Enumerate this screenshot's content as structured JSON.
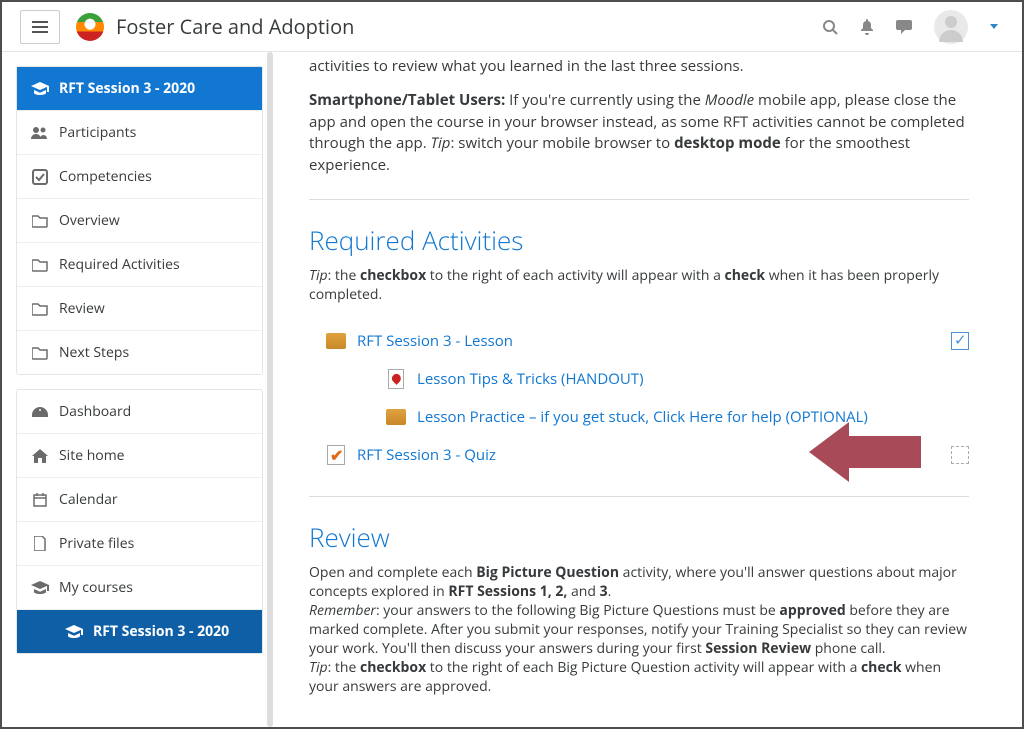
{
  "header": {
    "site_name": "Foster Care and Adoption"
  },
  "sidebar": {
    "course_items": [
      {
        "label": "RFT Session 3 - 2020",
        "icon": "graduation",
        "active": true
      },
      {
        "label": "Participants",
        "icon": "users"
      },
      {
        "label": "Competencies",
        "icon": "check-square"
      },
      {
        "label": "Overview",
        "icon": "folder"
      },
      {
        "label": "Required Activities",
        "icon": "folder"
      },
      {
        "label": "Review",
        "icon": "folder"
      },
      {
        "label": "Next Steps",
        "icon": "folder"
      }
    ],
    "global_items": [
      {
        "label": "Dashboard",
        "icon": "tachometer"
      },
      {
        "label": "Site home",
        "icon": "home"
      },
      {
        "label": "Calendar",
        "icon": "calendar"
      },
      {
        "label": "Private files",
        "icon": "file"
      },
      {
        "label": "My courses",
        "icon": "graduation"
      },
      {
        "label": "RFT Session 3 - 2020",
        "icon": "graduation",
        "active_bottom": true
      }
    ]
  },
  "intro": {
    "line1": "activities to review what you learned in the last three sessions.",
    "smartphone_label": "Smartphone/Tablet Users:",
    "smartphone_body_1": " If you're currently using the ",
    "smartphone_moodle": "Moodle",
    "smartphone_body_2": " mobile app, please close the app and open the course in your browser instead, as some RFT activities cannot be completed through the app. ",
    "tip_label": "Tip",
    "tip_body_1": ": switch your mobile browser to ",
    "tip_bold": "desktop mode",
    "tip_body_2": " for the smoothest experience."
  },
  "required": {
    "title": "Required Activities",
    "tip_label": "Tip",
    "tip_1": ": the ",
    "tip_bold1": "checkbox",
    "tip_2": " to the right of each activity will appear with a ",
    "tip_bold2": "check",
    "tip_3": " when it has been properly completed.",
    "activities": [
      {
        "label": "RFT Session 3 - Lesson",
        "icon": "box",
        "indent": 1,
        "completion": "done"
      },
      {
        "label": "Lesson Tips & Tricks (HANDOUT)",
        "icon": "pdf",
        "indent": 2
      },
      {
        "label": "Lesson Practice – if you get stuck, Click Here for help (OPTIONAL)",
        "icon": "box",
        "indent": 2
      },
      {
        "label": "RFT Session 3 - Quiz",
        "icon": "quiz",
        "indent": 1,
        "completion": "pending"
      }
    ]
  },
  "review": {
    "title": "Review",
    "p1_a": "Open and complete each ",
    "p1_bold1": "Big Picture Question",
    "p1_b": " activity, where you'll answer questions about major concepts explored in ",
    "p1_bold2": "RFT Sessions 1, 2,",
    "p1_c": " and ",
    "p1_bold3": "3",
    "p1_d": ".",
    "p2_rem": "Remember",
    "p2_a": ": your answers to the following Big Picture Questions must be ",
    "p2_bold1": "approved",
    "p2_b": " before they are marked complete. After you submit your responses, notify your Training Specialist so they can review your work. You'll then discuss your answers during your first ",
    "p2_bold2": "Session Review",
    "p2_c": " phone call.",
    "p3_tip": "Tip",
    "p3_a": ": the ",
    "p3_bold1": "checkbox",
    "p3_b": " to the right of each Big Picture Question activity will appear with a ",
    "p3_bold2": "check",
    "p3_c": " when your answers are approved."
  }
}
